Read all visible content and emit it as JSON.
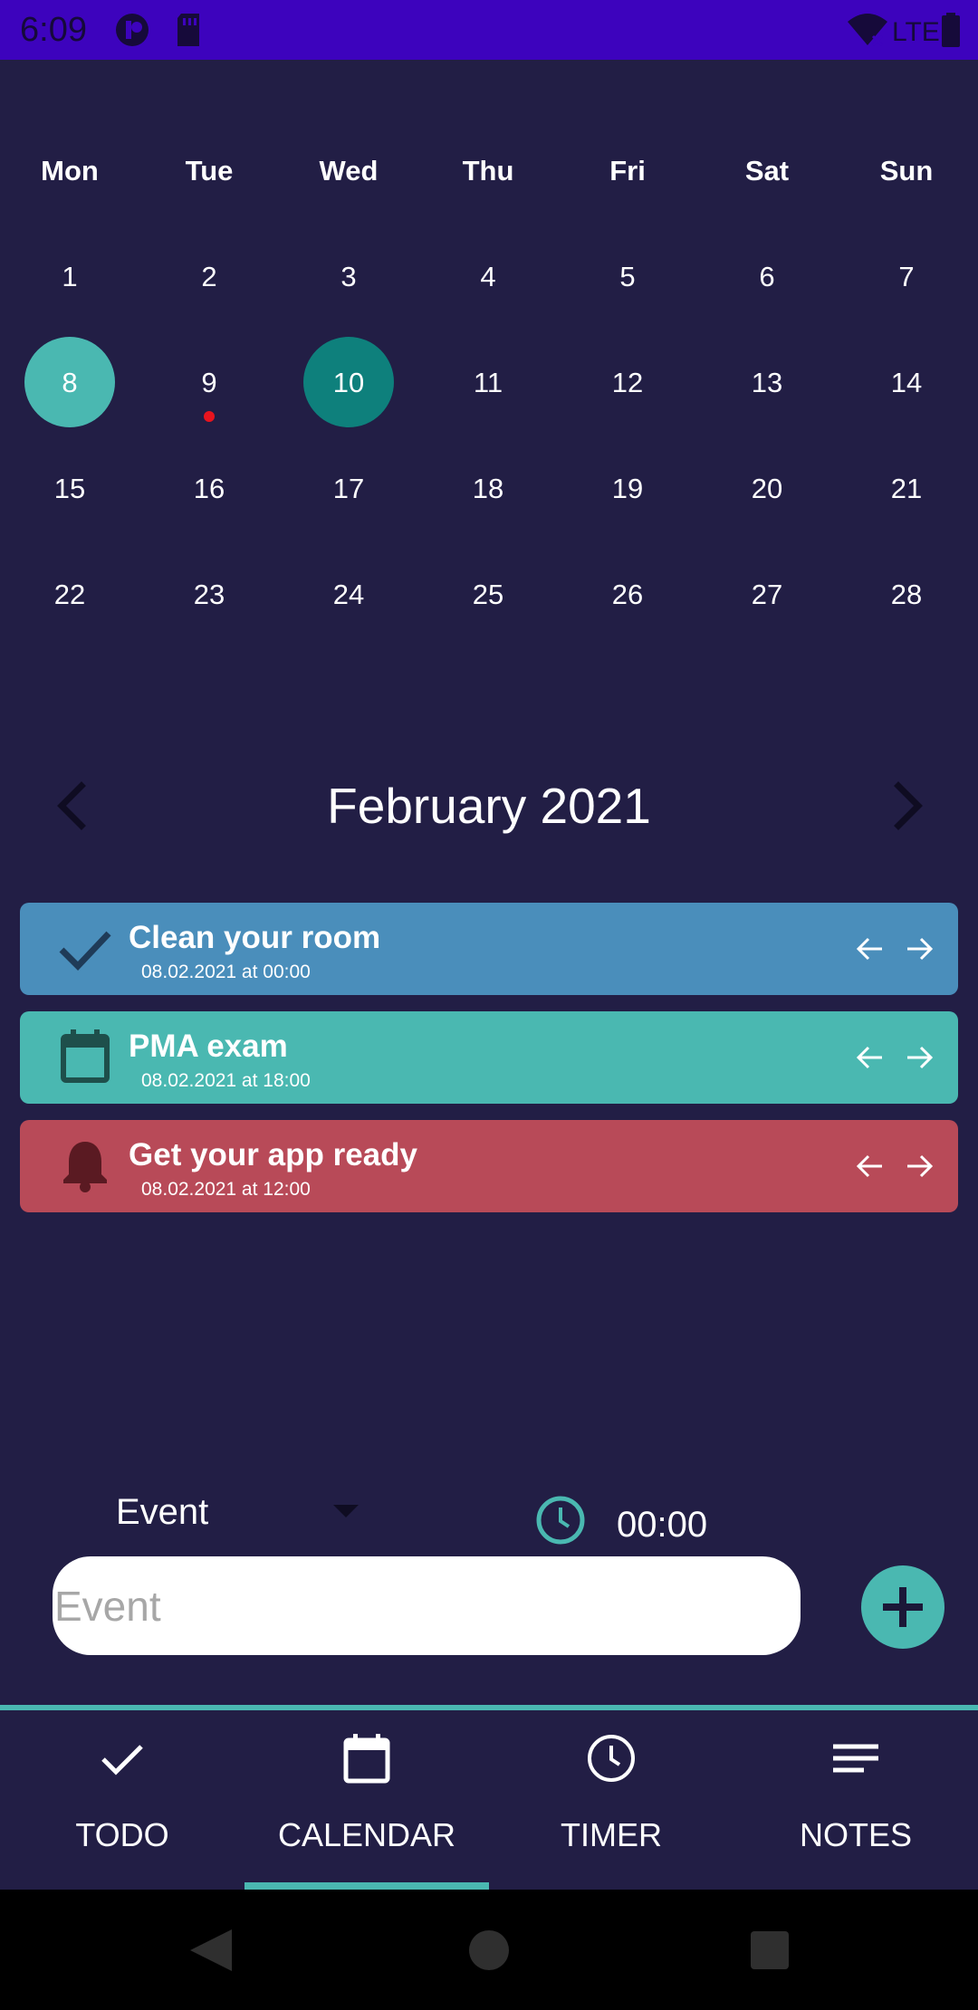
{
  "status_bar": {
    "time": "6:09",
    "network": "LTE"
  },
  "calendar": {
    "weekdays": [
      "Mon",
      "Tue",
      "Wed",
      "Thu",
      "Fri",
      "Sat",
      "Sun"
    ],
    "weeks": [
      [
        "1",
        "2",
        "3",
        "4",
        "5",
        "6",
        "7"
      ],
      [
        "8",
        "9",
        "10",
        "11",
        "12",
        "13",
        "14"
      ],
      [
        "15",
        "16",
        "17",
        "18",
        "19",
        "20",
        "21"
      ],
      [
        "22",
        "23",
        "24",
        "25",
        "26",
        "27",
        "28"
      ]
    ],
    "selected_day": "8",
    "today": "10",
    "days_with_events": [
      "9"
    ],
    "month_title": "February 2021"
  },
  "events": [
    {
      "title": "Clean your room",
      "date": "08.02.2021 at 00:00",
      "type": "todo",
      "icon": "check-icon",
      "color": "#4a8ebb"
    },
    {
      "title": "PMA exam",
      "date": "08.02.2021 at 18:00",
      "type": "event",
      "icon": "calendar-icon",
      "color": "#4ab8b1"
    },
    {
      "title": "Get your app ready",
      "date": "08.02.2021 at 12:00",
      "type": "reminder",
      "icon": "bell-icon",
      "color": "#b84a58"
    }
  ],
  "composer": {
    "type_selected": "Event",
    "time": "00:00",
    "input_placeholder": "Event",
    "input_value": ""
  },
  "bottom_nav": {
    "items": [
      {
        "label": "TODO",
        "icon": "check-icon"
      },
      {
        "label": "CALENDAR",
        "icon": "calendar-icon"
      },
      {
        "label": "TIMER",
        "icon": "clock-icon"
      },
      {
        "label": "NOTES",
        "icon": "notes-icon"
      }
    ],
    "active": "CALENDAR"
  },
  "colors": {
    "background": "#221e45",
    "status_bar": "#3d03bd",
    "accent": "#4ab8b1",
    "today_circle": "#0e807c",
    "event_dot": "#e8141e"
  }
}
